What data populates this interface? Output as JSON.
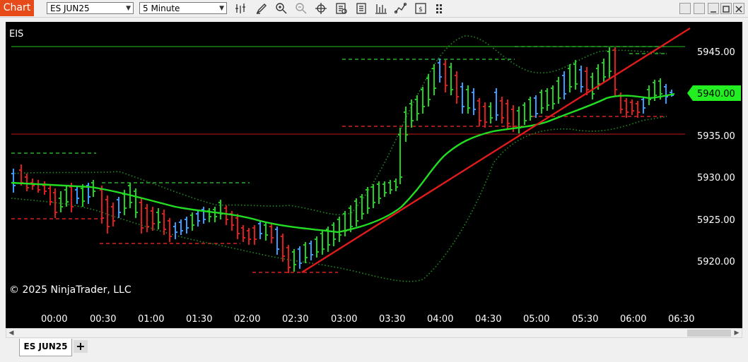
{
  "window": {
    "title": "Chart"
  },
  "toolbar": {
    "instrument": "ES JUN25",
    "interval": "5 Minute",
    "tools": [
      "bar-spacing-icon",
      "draw-pencil-icon",
      "zoom-in-icon",
      "zoom-out-icon",
      "crosshair-icon",
      "data-box-icon",
      "properties-icon",
      "indicators-icon",
      "strategies-icon",
      "chart-trader-icon",
      "more-icon"
    ]
  },
  "chart": {
    "instrument_label": "EIS",
    "copyright": "© 2025 NinjaTrader, LLC",
    "last_price": "5940.00",
    "price_axis": [
      "5945.00",
      "5940.00",
      "5935.00",
      "5930.00",
      "5925.00",
      "5920.00"
    ],
    "time_axis": [
      "00:00",
      "00:30",
      "01:00",
      "01:30",
      "02:00",
      "02:30",
      "03:00",
      "03:30",
      "04:00",
      "04:30",
      "05:00",
      "05:30",
      "06:00",
      "06:30"
    ],
    "colors": {
      "up_bar": "#1fd11f",
      "down_bar": "#e01b1b",
      "neutral_bar": "#3a9bff",
      "ma_line": "#22dd22",
      "trend_line": "#e01b1b",
      "band": "#1f8f1f",
      "accent": "#22ee22"
    }
  },
  "tabs": [
    {
      "label": "ES JUN25",
      "active": true
    }
  ],
  "tab_add": "+"
}
